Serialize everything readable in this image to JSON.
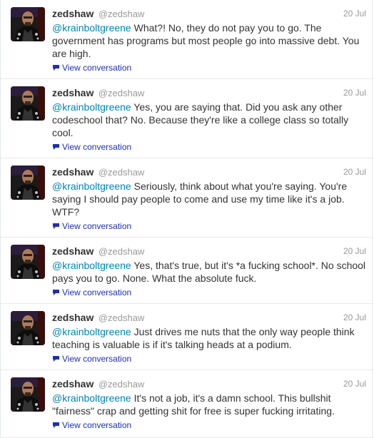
{
  "tweets": [
    {
      "fullname": "zedshaw",
      "username": "@zedshaw",
      "time": "20 Jul",
      "mention": "@krainboltgreene",
      "text": " What?! No, they do not pay you to go. The government has programs but most people go into massive debt. You are high.",
      "view": "View conversation"
    },
    {
      "fullname": "zedshaw",
      "username": "@zedshaw",
      "time": "20 Jul",
      "mention": "@krainboltgreene",
      "text": " Yes, you are saying that. Did you ask any other codeschool that? No. Because they're like a college class so totally cool.",
      "view": "View conversation"
    },
    {
      "fullname": "zedshaw",
      "username": "@zedshaw",
      "time": "20 Jul",
      "mention": "@krainboltgreene",
      "text": " Seriously, think about what you're saying.  You're saying I should pay people to come and use my time like it's a job. WTF?",
      "view": "View conversation"
    },
    {
      "fullname": "zedshaw",
      "username": "@zedshaw",
      "time": "20 Jul",
      "mention": "@krainboltgreene",
      "text": " Yes, that's true, but it's *a fucking school*. No school pays you to go. None. What the absolute fuck.",
      "view": "View conversation"
    },
    {
      "fullname": "zedshaw",
      "username": "@zedshaw",
      "time": "20 Jul",
      "mention": "@krainboltgreene",
      "text": " Just drives me nuts that the only way people think teaching is valuable is if it's talking heads at a podium.",
      "view": "View conversation"
    },
    {
      "fullname": "zedshaw",
      "username": "@zedshaw",
      "time": "20 Jul",
      "mention": "@krainboltgreene",
      "text": " It's not a job, it's a damn school. This bullshit \"fairness\" crap and getting shit for free is super fucking irritating.",
      "view": "View conversation"
    }
  ],
  "colors": {
    "mention": "#0084b4",
    "link": "#1f2fb5",
    "meta": "#999999",
    "text": "#333333"
  },
  "icons": {
    "view_conversation": "speech-bubble-icon",
    "avatar": "user-avatar"
  }
}
